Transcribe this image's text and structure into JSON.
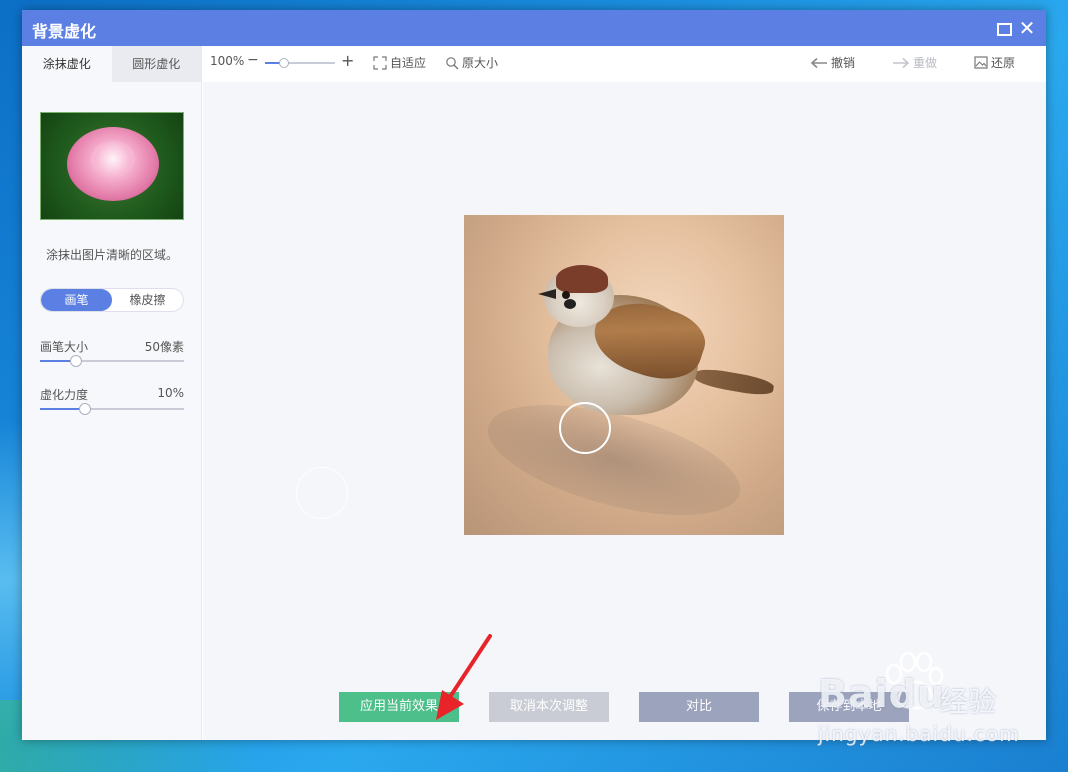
{
  "window": {
    "title": "背景虚化",
    "maximize_icon": "maximize-icon",
    "close_icon": "close-icon",
    "close_glyph": "✕"
  },
  "sidebar": {
    "tabs": [
      {
        "label": "涂抹虚化",
        "active": true
      },
      {
        "label": "圆形虚化",
        "active": false
      }
    ],
    "hint": "涂抹出图片清晰的区域。",
    "tool_toggle": {
      "options": [
        "画笔",
        "橡皮擦"
      ],
      "selected": "画笔"
    },
    "brush_size": {
      "label": "画笔大小",
      "value": "50像素",
      "fraction": 0.25
    },
    "blur_strength": {
      "label": "虚化力度",
      "value": "10%",
      "fraction": 0.31
    }
  },
  "toolbar": {
    "zoom_value": "100%",
    "zoom_minus": "−",
    "zoom_plus": "+",
    "zoom_fraction": 0.2,
    "fit_label": "自适应",
    "original_size_label": "原大小",
    "undo_label": "撤销",
    "redo_label": "重做",
    "restore_label": "还原"
  },
  "actions": {
    "apply": "应用当前效果",
    "cancel": "取消本次调整",
    "compare": "对比",
    "save": "保存到本地"
  },
  "watermark": {
    "brand": "Baidu",
    "brand_cn": "经验",
    "url": "jingyan.baidu.com"
  },
  "colors": {
    "accent": "#5b7fe2",
    "apply": "#4dbf8a",
    "arrow": "#e8242a"
  }
}
